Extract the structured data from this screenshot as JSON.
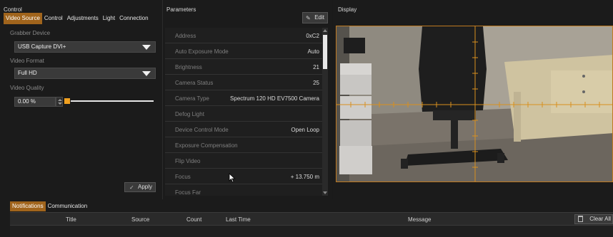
{
  "control": {
    "title": "Control",
    "tabs": [
      "Video Source",
      "Control",
      "Adjustments",
      "Light",
      "Connection"
    ],
    "grabber_label": "Grabber Device",
    "grabber_value": "USB Capture DVI+",
    "format_label": "Video Format",
    "format_value": "Full HD",
    "quality_label": "Video Quality",
    "quality_value": "0.00 %",
    "quality_level": 0,
    "apply_label": "Apply"
  },
  "parameters": {
    "title": "Parameters",
    "edit_label": "Edit",
    "rows": [
      {
        "name": "Address",
        "value": "0xC2"
      },
      {
        "name": "Auto Exposure Mode",
        "value": "Auto"
      },
      {
        "name": "Brightness",
        "value": "21"
      },
      {
        "name": "Camera Status",
        "value": "25"
      },
      {
        "name": "Camera Type",
        "value": "Spectrum 120 HD EV7500 Camera"
      },
      {
        "name": "Defog Light",
        "value": ""
      },
      {
        "name": "Device Control Mode",
        "value": "Open Loop"
      },
      {
        "name": "Exposure Compensation",
        "value": ""
      },
      {
        "name": "Flip Video",
        "value": ""
      },
      {
        "name": "Focus",
        "value": "+ 13.750 m"
      },
      {
        "name": "Focus Far",
        "value": ""
      }
    ]
  },
  "display": {
    "title": "Display"
  },
  "notifications": {
    "tabs": [
      "Notifications",
      "Communication"
    ],
    "columns": [
      "Title",
      "Source",
      "Count",
      "Last Time",
      "Message"
    ],
    "clear_label": "Clear All"
  },
  "colors": {
    "accent": "#a0641c",
    "crosshair": "#d9901e"
  }
}
